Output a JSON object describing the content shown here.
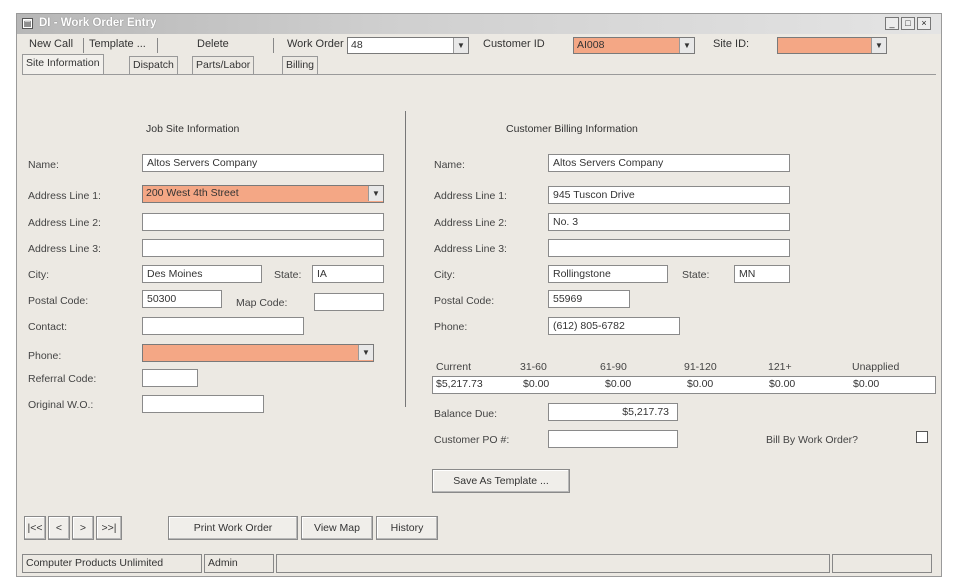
{
  "window": {
    "title": "DI - Work Order Entry"
  },
  "menubar": {
    "new_call": "New Call",
    "template": "Template ...",
    "delete": "Delete",
    "work_order_label": "Work Order",
    "work_order_value": "48",
    "customer_id_label": "Customer ID",
    "customer_id_value": "AI008",
    "site_id_label": "Site ID:",
    "site_id_value": ""
  },
  "tabs": [
    "Site Information",
    "Dispatch",
    "Parts/Labor",
    "Billing"
  ],
  "job_site": {
    "header": "Job Site Information",
    "name_label": "Name:",
    "name_value": "Altos Servers Company",
    "addr1_label": "Address Line 1:",
    "addr1_value": "200 West 4th Street",
    "addr2_label": "Address Line 2:",
    "addr2_value": "",
    "addr3_label": "Address Line 3:",
    "addr3_value": "",
    "city_label": "City:",
    "city_value": "Des Moines",
    "state_label": "State:",
    "state_value": "IA",
    "postal_label": "Postal Code:",
    "postal_value": "50300",
    "map_label": "Map Code:",
    "map_value": "",
    "contact_label": "Contact:",
    "contact_value": "",
    "phone_label": "Phone:",
    "phone_value": "",
    "referral_label": "Referral Code:",
    "referral_value": "",
    "orig_wo_label": "Original W.O.:",
    "orig_wo_value": ""
  },
  "billing": {
    "header": "Customer Billing Information",
    "name_label": "Name:",
    "name_value": "Altos Servers Company",
    "addr1_label": "Address Line 1:",
    "addr1_value": "945 Tuscon Drive",
    "addr2_label": "Address Line 2:",
    "addr2_value": "No. 3",
    "addr3_label": "Address Line 3:",
    "addr3_value": "",
    "city_label": "City:",
    "city_value": "Rollingstone",
    "state_label": "State:",
    "state_value": "MN",
    "postal_label": "Postal Code:",
    "postal_value": "55969",
    "phone_label": "Phone:",
    "phone_value": "(612) 805-6782",
    "aging_headers": [
      "Current",
      "31-60",
      "61-90",
      "91-120",
      "121+",
      "Unapplied"
    ],
    "aging_values": [
      "$5,217.73",
      "$0.00",
      "$0.00",
      "$0.00",
      "$0.00",
      "$0.00"
    ],
    "balance_label": "Balance Due:",
    "balance_value": "$5,217.73",
    "po_label": "Customer PO #:",
    "po_value": "",
    "bill_by_wo_label": "Bill By Work Order?",
    "bill_by_wo_checked": false,
    "save_template_label": "Save As Template ..."
  },
  "nav": {
    "first": "|<<",
    "prev": "<",
    "next": ">",
    "last": ">>|",
    "print_label": "Print Work Order",
    "view_map_label": "View Map",
    "history_label": "History"
  },
  "status": {
    "company": "Computer Products Unlimited",
    "user": "Admin"
  }
}
